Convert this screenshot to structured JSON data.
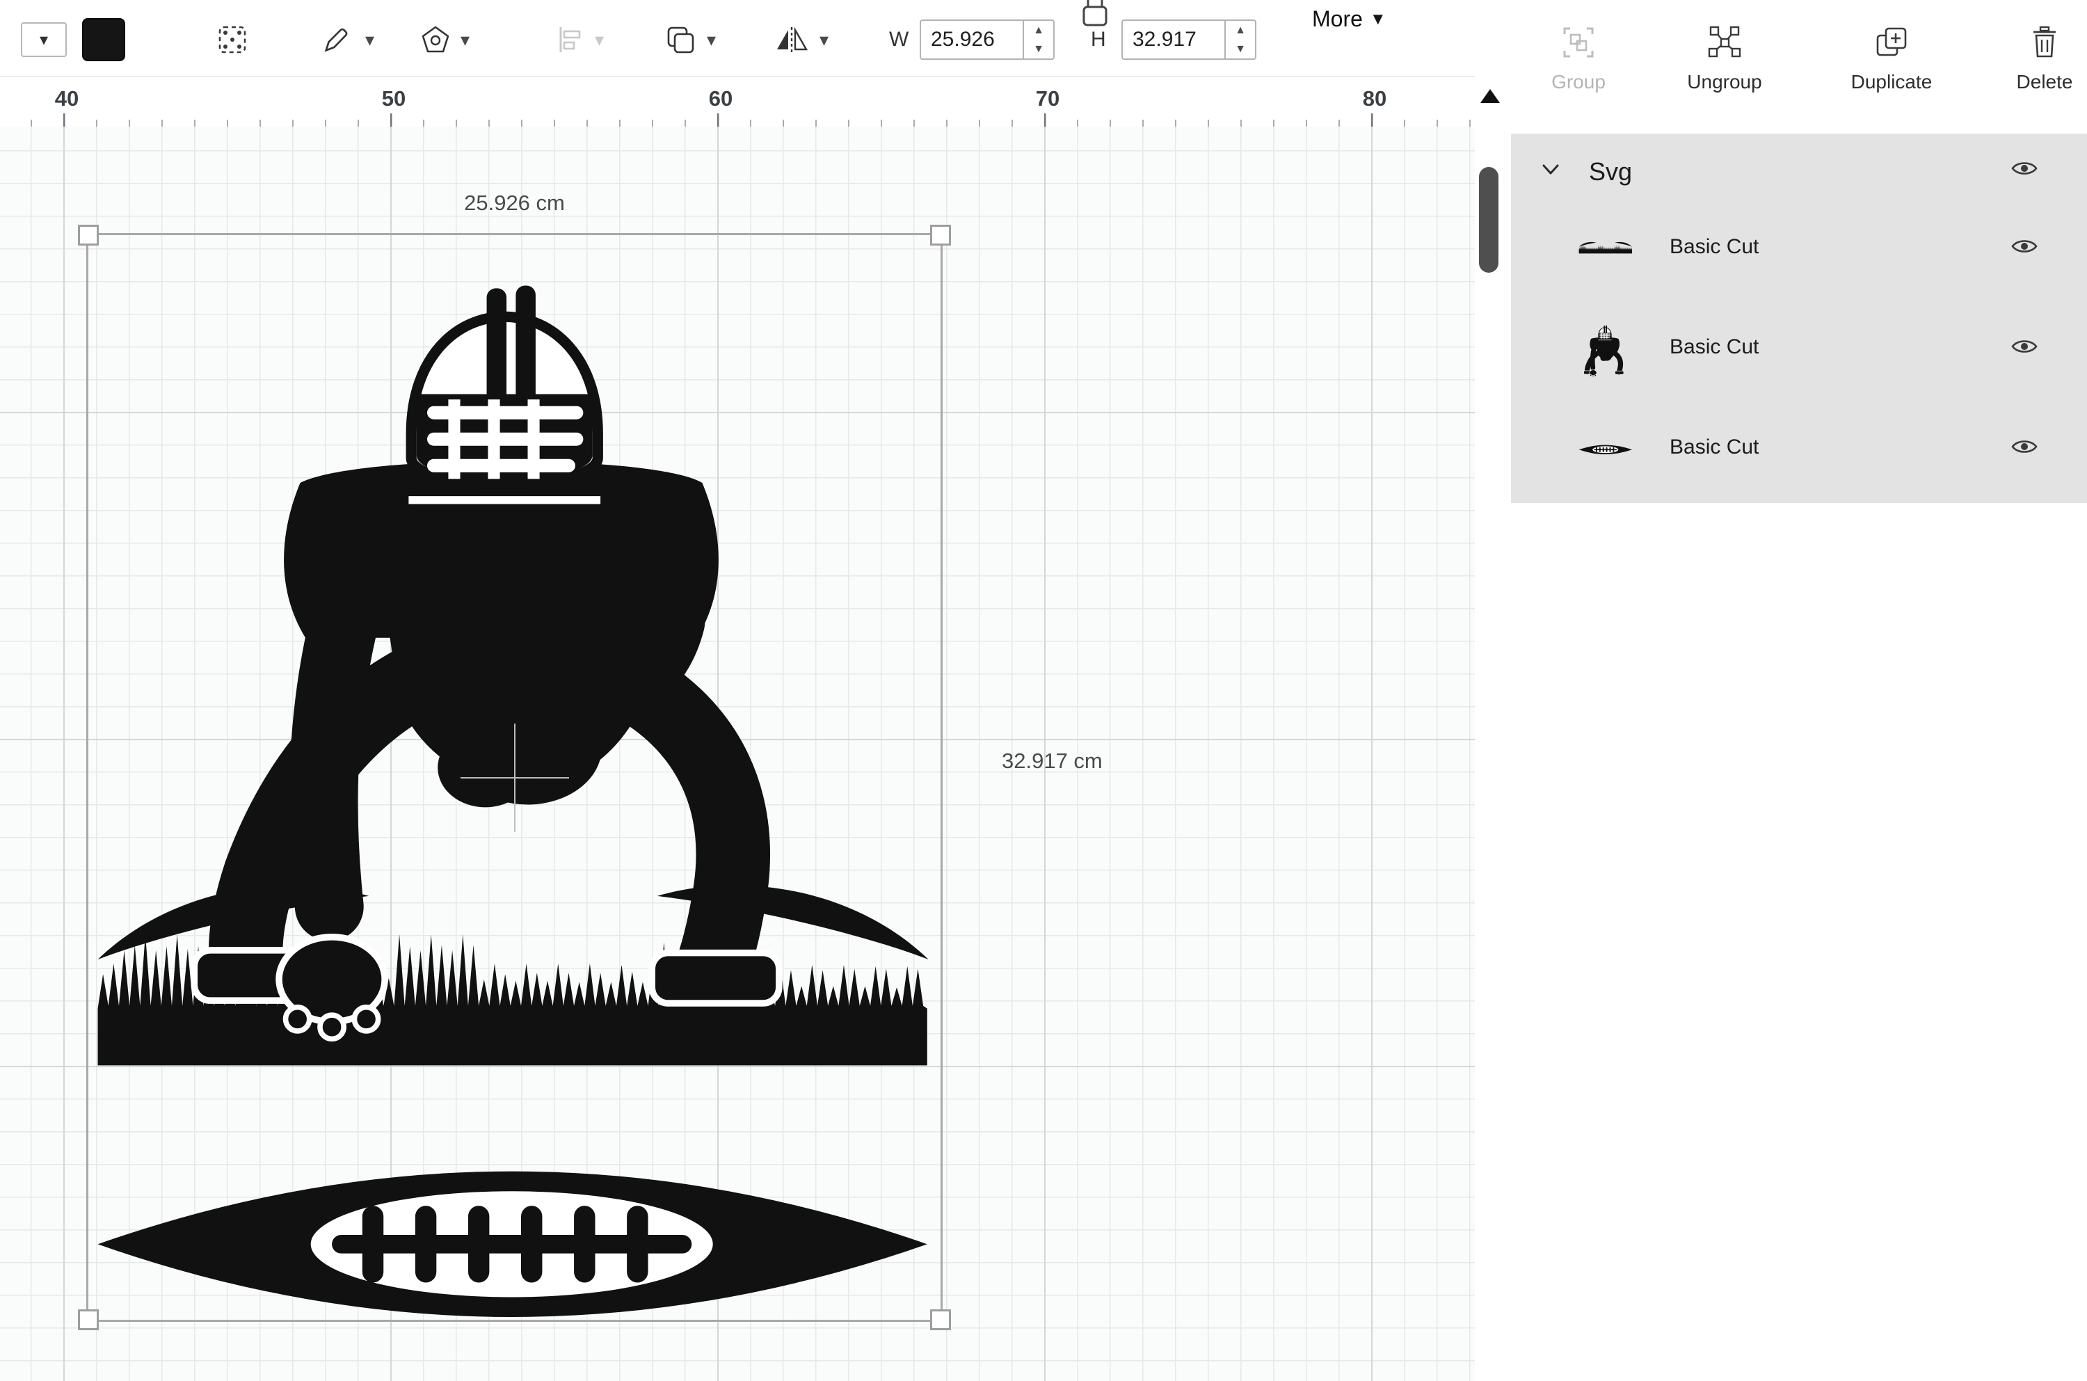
{
  "toolbar": {
    "w_label": "W",
    "w_value": "25.926",
    "h_label": "H",
    "h_value": "32.917",
    "more_label": "More"
  },
  "icons": {
    "caret_down": "▾",
    "stepper_up": "▲",
    "stepper_down": "▼"
  },
  "ruler": {
    "ticks": [
      "40",
      "50",
      "60",
      "70",
      "80"
    ]
  },
  "canvas": {
    "selection": {
      "width_text": "25.926 cm",
      "height_text": "32.917 cm"
    }
  },
  "layers_panel": {
    "actions": [
      {
        "label": "Group",
        "disabled": true
      },
      {
        "label": "Ungroup",
        "disabled": false
      },
      {
        "label": "Duplicate",
        "disabled": false
      },
      {
        "label": "Delete",
        "disabled": false
      }
    ],
    "group_name": "Svg",
    "layers": [
      {
        "label": "Basic Cut",
        "thumb": "grass"
      },
      {
        "label": "Basic Cut",
        "thumb": "player"
      },
      {
        "label": "Basic Cut",
        "thumb": "laces"
      }
    ]
  },
  "colors": {
    "art": "#111111",
    "selection_border": "#a8a8a8",
    "panel_bg": "#e3e3e3"
  }
}
